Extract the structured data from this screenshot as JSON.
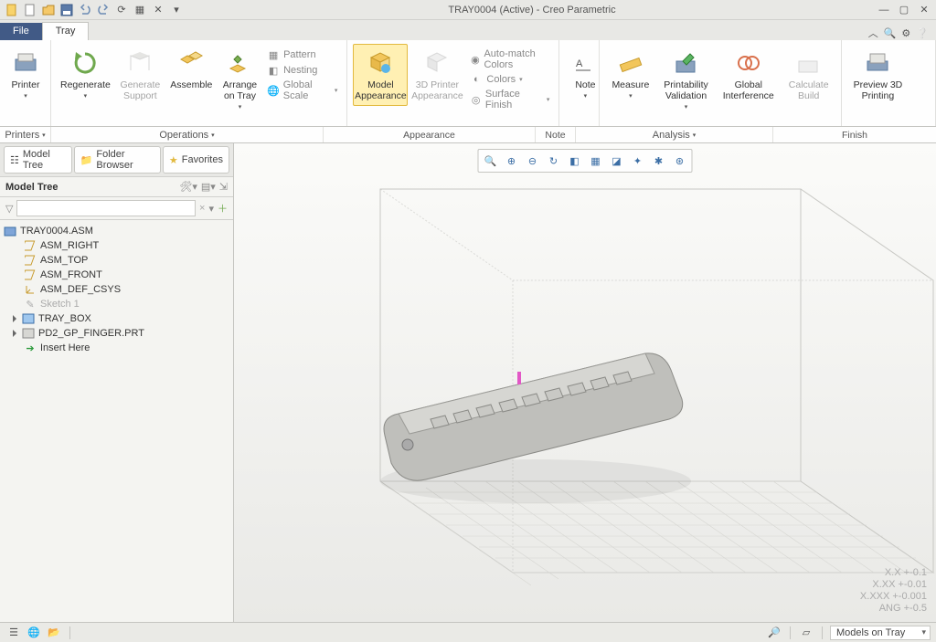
{
  "title": "TRAY0004 (Active) - Creo Parametric",
  "tabs": {
    "file": "File",
    "tray": "Tray"
  },
  "ribbon": {
    "printer": "Printer",
    "regenerate": "Regenerate",
    "generate_support": "Generate\nSupport",
    "assemble": "Assemble",
    "arrange_on_tray": "Arrange\non Tray",
    "pattern": "Pattern",
    "nesting": "Nesting",
    "global_scale": "Global Scale",
    "model_appearance": "Model\nAppearance",
    "printer_appearance": "3D Printer\nAppearance",
    "automatch": "Auto-match Colors",
    "colors": "Colors",
    "surface_finish": "Surface Finish",
    "note": "Note",
    "measure": "Measure",
    "printability_validation": "Printability\nValidation",
    "global_interference": "Global\nInterference",
    "calculate_build": "Calculate\nBuild",
    "preview_3d_printing": "Preview 3D\nPrinting",
    "groups": {
      "printers": "Printers",
      "operations": "Operations",
      "appearance": "Appearance",
      "note": "Note",
      "analysis": "Analysis",
      "finish": "Finish"
    }
  },
  "side_tabs": {
    "model_tree": "Model Tree",
    "folder_browser": "Folder Browser",
    "favorites": "Favorites"
  },
  "tree_title": "Model Tree",
  "tree": {
    "root": "TRAY0004.ASM",
    "items": [
      "ASM_RIGHT",
      "ASM_TOP",
      "ASM_FRONT",
      "ASM_DEF_CSYS",
      "Sketch 1",
      "TRAY_BOX",
      "PD2_GP_FINGER.PRT",
      "Insert Here"
    ]
  },
  "coords": [
    "X.X +-0.1",
    "X.XX +-0.01",
    "X.XXX +-0.001",
    "ANG +-0.5"
  ],
  "status_dd": "Models on Tray"
}
